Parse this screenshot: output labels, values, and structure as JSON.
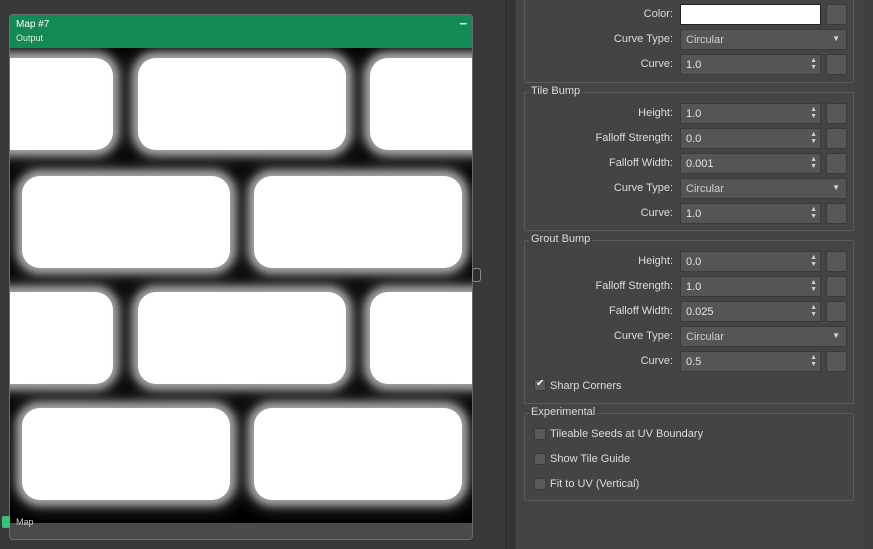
{
  "node": {
    "title": "Map #7",
    "subtitle": "Output",
    "collapse_glyph": "−",
    "footer_label": "Map",
    "header_color": "#138a54"
  },
  "top_group": {
    "color_label": "Color:",
    "color_value": "#ffffff",
    "curve_type_label": "Curve Type:",
    "curve_type_value": "Circular",
    "curve_label": "Curve:",
    "curve_value": "1.0"
  },
  "tile_bump": {
    "title": "Tile Bump",
    "height_label": "Height:",
    "height_value": "1.0",
    "falloff_strength_label": "Falloff Strength:",
    "falloff_strength_value": "0.0",
    "falloff_width_label": "Falloff Width:",
    "falloff_width_value": "0.001",
    "curve_type_label": "Curve Type:",
    "curve_type_value": "Circular",
    "curve_label": "Curve:",
    "curve_value": "1.0"
  },
  "grout_bump": {
    "title": "Grout Bump",
    "height_label": "Height:",
    "height_value": "0.0",
    "falloff_strength_label": "Falloff Strength:",
    "falloff_strength_value": "1.0",
    "falloff_width_label": "Falloff Width:",
    "falloff_width_value": "0.025",
    "curve_type_label": "Curve Type:",
    "curve_type_value": "Circular",
    "curve_label": "Curve:",
    "curve_value": "0.5",
    "sharp_corners_label": "Sharp Corners",
    "sharp_corners_checked": true
  },
  "experimental": {
    "title": "Experimental",
    "tileable_seeds_label": "Tileable Seeds at UV Boundary",
    "tileable_seeds_checked": false,
    "show_tile_guide_label": "Show Tile Guide",
    "show_tile_guide_checked": false,
    "fit_to_uv_label": "Fit to UV (Vertical)",
    "fit_to_uv_checked": false
  },
  "icons": {
    "spinner": "spinner-arrows-icon",
    "dropdown": "chevron-down-icon",
    "check": "checkmark-icon"
  }
}
